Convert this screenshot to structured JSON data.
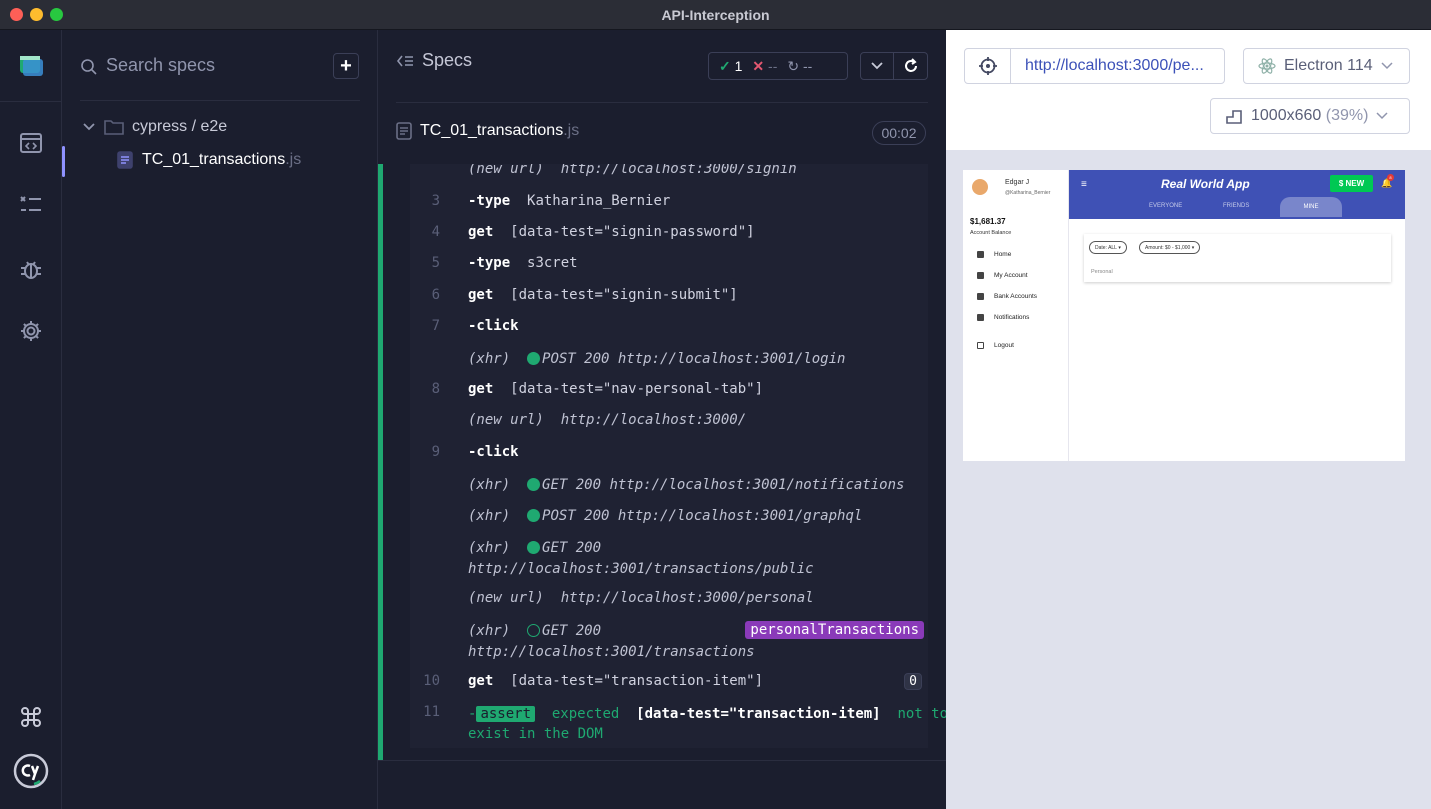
{
  "window": {
    "title": "API-Interception",
    "traffic_lights": {
      "close": "#fe5f57",
      "minimize": "#febc2e",
      "maximize": "#28c840"
    }
  },
  "rail": {
    "items": [
      "cypress-app-logo",
      "runs-icon",
      "specs-list-icon",
      "debug-bug-icon",
      "settings-gear-icon",
      "keyboard-shortcuts-icon",
      "cypress-cy-logo"
    ]
  },
  "specs_panel": {
    "search_placeholder": "Search specs",
    "add_button": "+",
    "folder": "cypress / e2e",
    "spec_name": "TC_01_transactions",
    "spec_ext": ".js"
  },
  "reporter": {
    "header": "Specs",
    "stats": {
      "passed": "1",
      "failed": "--",
      "pending": "--"
    },
    "file_name": "TC_01_transactions",
    "file_ext": ".js",
    "timer": "00:02",
    "commands": [
      {
        "num": "",
        "kind": "event",
        "label": "(new url)",
        "text": "http://localhost:3000/signin"
      },
      {
        "num": "3",
        "kind": "child",
        "label": "-type",
        "text": "Katharina_Bernier"
      },
      {
        "num": "4",
        "kind": "parent",
        "label": "get",
        "text": "[data-test=\"signin-password\"]"
      },
      {
        "num": "5",
        "kind": "child",
        "label": "-type",
        "text": "s3cret"
      },
      {
        "num": "6",
        "kind": "parent",
        "label": "get",
        "text": "[data-test=\"signin-submit\"]"
      },
      {
        "num": "7",
        "kind": "child",
        "label": "-click",
        "text": ""
      },
      {
        "num": "",
        "kind": "xhr",
        "label": "(xhr)",
        "text": "POST 200 http://localhost:3001/login"
      },
      {
        "num": "8",
        "kind": "parent",
        "label": "get",
        "text": "[data-test=\"nav-personal-tab\"]"
      },
      {
        "num": "",
        "kind": "event",
        "label": "(new url)",
        "text": "http://localhost:3000/"
      },
      {
        "num": "9",
        "kind": "child",
        "label": "-click",
        "text": ""
      },
      {
        "num": "",
        "kind": "xhr",
        "label": "(xhr)",
        "text": "GET 200 http://localhost:3001/notifications"
      },
      {
        "num": "",
        "kind": "xhr",
        "label": "(xhr)",
        "text": "POST 200 http://localhost:3001/graphql"
      },
      {
        "num": "",
        "kind": "xhr",
        "label": "(xhr)",
        "text": "GET 200",
        "text2": "http://localhost:3001/transactions/public"
      },
      {
        "num": "",
        "kind": "event",
        "label": "(new url)",
        "text": "http://localhost:3000/personal"
      },
      {
        "num": "",
        "kind": "xhr-pending",
        "label": "(xhr)",
        "text": "GET 200",
        "text2": "http://localhost:3001/transactions",
        "alias": "personalTransactions"
      },
      {
        "num": "10",
        "kind": "parent",
        "label": "get",
        "text": "[data-test=\"transaction-item\"]",
        "badge": "0"
      },
      {
        "num": "11",
        "kind": "assert",
        "label": "assert",
        "text": "expected",
        "subject": "[data-test=\"transaction-item]",
        "text3": "not to",
        "text4": "exist in the DOM"
      }
    ]
  },
  "preview": {
    "url": "http://localhost:3000/pe...",
    "browser": "Electron 114",
    "viewport": "1000x660",
    "scale": "(39%)",
    "app": {
      "title": "Real World App",
      "new_button": "$ NEW",
      "notif_count": "8",
      "tabs": [
        "EVERYONE",
        "FRIENDS",
        "MINE"
      ],
      "user_name": "Edgar J",
      "user_handle": "@Katharina_Bernier",
      "balance": "$1,681.37",
      "balance_label": "Account Balance",
      "nav": [
        "Home",
        "My Account",
        "Bank Accounts",
        "Notifications",
        "Logout"
      ],
      "filters": [
        "Date: ALL",
        "Amount: $0 - $1,000"
      ],
      "section": "Personal"
    }
  }
}
